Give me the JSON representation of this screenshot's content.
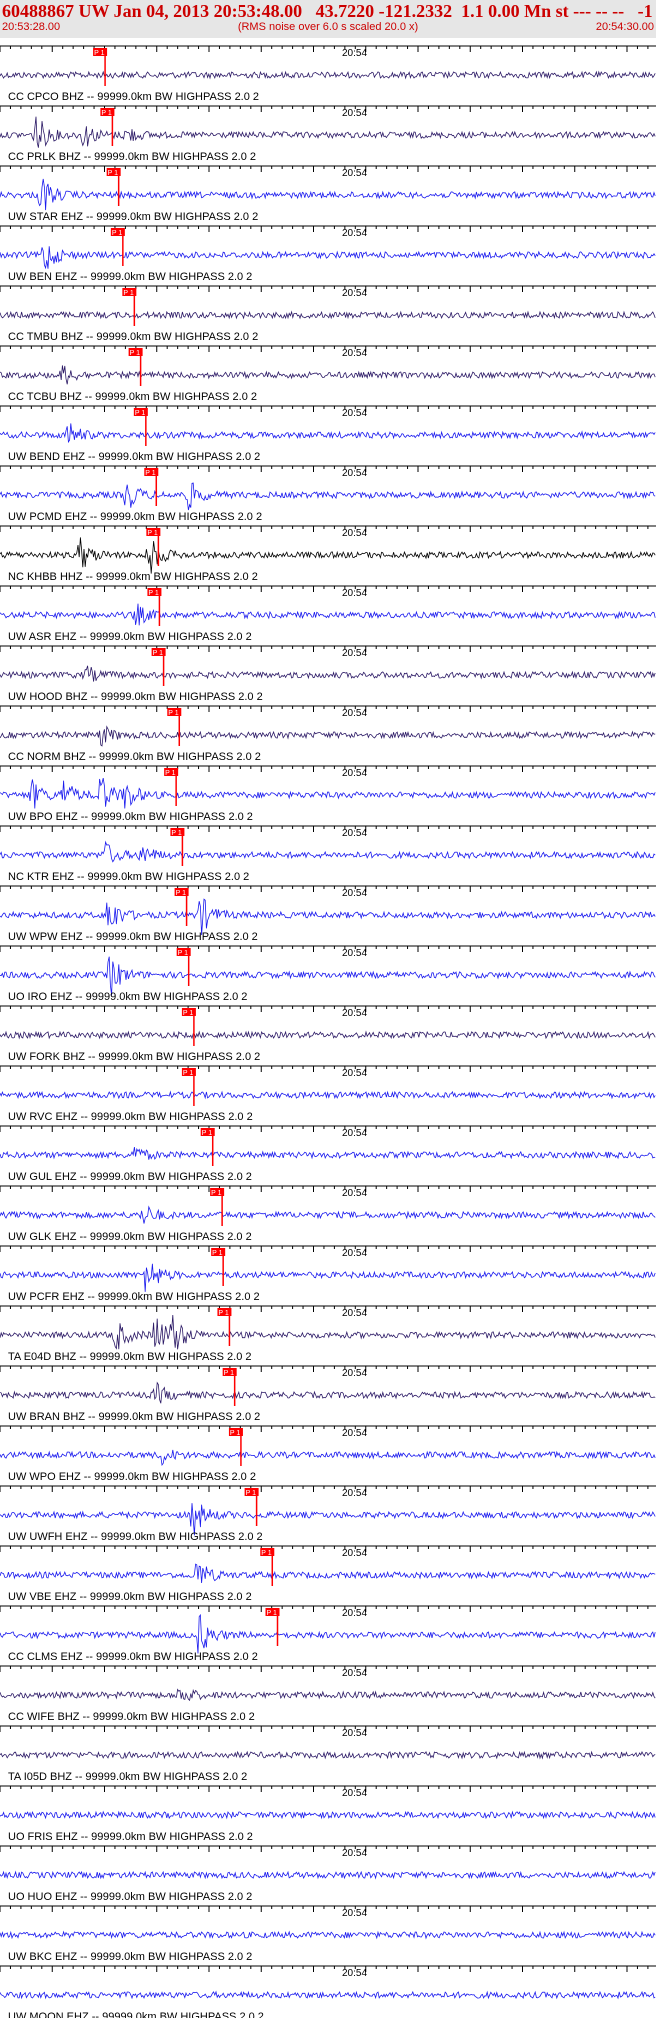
{
  "header": {
    "title": "60488867 UW Jan 04, 2013 20:53:48.00   43.7220 -121.2332  1.1 0.00 Mn st --- -- --   -1",
    "start_time": "20:53:28.00",
    "end_time": "20:54:30.00",
    "noise_note": "(RMS noise over 6.0 s scaled 20.0 x)"
  },
  "colors": {
    "pick": "#ff0000",
    "axis": "#000000",
    "text": "#000000",
    "label_bg": "#e6e6e6"
  },
  "chart_data": {
    "type": "line",
    "title": "60488867 UW Jan 04, 2013 20:53:48.00",
    "x_range": [
      "20:53:28.00",
      "20:54:30.00"
    ],
    "tick_label": "20:54",
    "pick_label": "P 1",
    "filter": "BW  HIGHPASS  2.0  2",
    "traces": [
      {
        "label": "CC CPCO BHZ -- 99999.0km",
        "color": "#2c1a66",
        "pick_s": 2.4,
        "events": []
      },
      {
        "label": "CC PRLK BHZ -- 99999.0km",
        "color": "#2c1a66",
        "pick_s": 3.1,
        "events": [
          [
            3.4,
            1.0
          ],
          [
            8.0,
            0.6
          ],
          [
            12.0,
            0.4
          ]
        ]
      },
      {
        "label": "UW STAR EHZ -- 99999.0km",
        "color": "#1a1aee",
        "pick_s": 3.7,
        "events": [
          [
            3.9,
            1.0
          ]
        ]
      },
      {
        "label": "UW BEN EHZ -- 99999.0km",
        "color": "#1a1aee",
        "pick_s": 4.1,
        "events": [
          [
            4.2,
            0.9
          ]
        ]
      },
      {
        "label": "CC TMBU BHZ -- 99999.0km",
        "color": "#2c1a66",
        "pick_s": 5.2,
        "events": []
      },
      {
        "label": "CC TCBU BHZ -- 99999.0km",
        "color": "#2c1a66",
        "pick_s": 5.8,
        "events": [
          [
            6.0,
            0.5
          ]
        ]
      },
      {
        "label": "UW BEND EHZ -- 99999.0km",
        "color": "#1a1aee",
        "pick_s": 6.3,
        "events": [
          [
            6.5,
            0.6
          ]
        ]
      },
      {
        "label": "UW PCMD EHZ -- 99999.0km",
        "color": "#1a1aee",
        "pick_s": 7.3,
        "events": [
          [
            12.0,
            0.8
          ],
          [
            18.0,
            0.7
          ]
        ]
      },
      {
        "label": "NC KHBB HHZ -- 99999.0km",
        "color": "#000000",
        "pick_s": 7.5,
        "events": [
          [
            7.6,
            0.8
          ],
          [
            14.2,
            1.0
          ]
        ]
      },
      {
        "label": "UW ASR EHZ -- 99999.0km",
        "color": "#1a1aee",
        "pick_s": 7.6,
        "events": [
          [
            13.0,
            0.5
          ]
        ]
      },
      {
        "label": "UW HOOD BHZ -- 99999.0km",
        "color": "#2c1a66",
        "pick_s": 8.0,
        "events": [
          [
            8.2,
            0.4
          ]
        ]
      },
      {
        "label": "CC NORM BHZ -- 99999.0km",
        "color": "#2c1a66",
        "pick_s": 9.5,
        "events": [
          [
            9.6,
            0.5
          ]
        ]
      },
      {
        "label": "UW BPO EHZ -- 99999.0km",
        "color": "#1a1aee",
        "pick_s": 9.2,
        "events": [
          [
            3.0,
            0.7
          ],
          [
            6.0,
            0.7
          ],
          [
            9.5,
            1.0
          ],
          [
            12.0,
            0.7
          ]
        ]
      },
      {
        "label": "NC KTR EHZ -- 99999.0km",
        "color": "#1a1aee",
        "pick_s": 9.8,
        "events": [
          [
            10.0,
            0.6
          ],
          [
            13.5,
            0.5
          ]
        ]
      },
      {
        "label": "UW WPW EHZ -- 99999.0km",
        "color": "#1a1aee",
        "pick_s": 10.2,
        "events": [
          [
            10.3,
            1.0
          ],
          [
            19.1,
            1.0
          ]
        ]
      },
      {
        "label": "UO IRO EHZ -- 99999.0km",
        "color": "#1a1aee",
        "pick_s": 10.4,
        "events": [
          [
            10.5,
            1.0
          ]
        ]
      },
      {
        "label": "UW FORK BHZ -- 99999.0km",
        "color": "#2c1a66",
        "pick_s": 10.9,
        "events": []
      },
      {
        "label": "UW RVC EHZ -- 99999.0km",
        "color": "#1a1aee",
        "pick_s": 10.9,
        "events": []
      },
      {
        "label": "UW GUL EHZ -- 99999.0km",
        "color": "#1a1aee",
        "pick_s": 12.7,
        "events": [
          [
            12.8,
            0.4
          ]
        ]
      },
      {
        "label": "UW GLK EHZ -- 99999.0km",
        "color": "#1a1aee",
        "pick_s": 13.6,
        "events": [
          [
            13.7,
            0.5
          ]
        ]
      },
      {
        "label": "UW PCFR EHZ -- 99999.0km",
        "color": "#1a1aee",
        "pick_s": 13.7,
        "events": [
          [
            14.0,
            1.0
          ]
        ]
      },
      {
        "label": "TA E04D BHZ -- 99999.0km",
        "color": "#2c1a66",
        "pick_s": 14.3,
        "events": [
          [
            11.0,
            0.8
          ],
          [
            14.8,
            1.0
          ],
          [
            16.5,
            0.9
          ]
        ]
      },
      {
        "label": "UW BRAN BHZ -- 99999.0km",
        "color": "#2c1a66",
        "pick_s": 14.8,
        "events": [
          [
            14.9,
            0.5
          ]
        ]
      },
      {
        "label": "UW WPO EHZ -- 99999.0km",
        "color": "#1a1aee",
        "pick_s": 15.4,
        "events": [
          [
            15.4,
            0.4
          ]
        ]
      },
      {
        "label": "UW UWFH EHZ -- 99999.0km",
        "color": "#1a1aee",
        "pick_s": 16.9,
        "events": [
          [
            18.4,
            1.0
          ]
        ]
      },
      {
        "label": "UW VBE EHZ -- 99999.0km",
        "color": "#1a1aee",
        "pick_s": 18.4,
        "events": [
          [
            18.8,
            0.8
          ]
        ]
      },
      {
        "label": "CC CLMS EHZ -- 99999.0km",
        "color": "#1a1aee",
        "pick_s": 18.9,
        "events": [
          [
            19.0,
            1.0
          ]
        ]
      },
      {
        "label": "CC WIFE BHZ -- 99999.0km",
        "color": "#2c1a66",
        "pick_s": null,
        "events": [
          [
            17.2,
            0.5
          ]
        ]
      },
      {
        "label": "TA I05D BHZ -- 99999.0km",
        "color": "#2c1a66",
        "pick_s": null,
        "events": []
      },
      {
        "label": "UO FRIS EHZ -- 99999.0km",
        "color": "#1a1aee",
        "pick_s": null,
        "events": []
      },
      {
        "label": "UO HUO EHZ -- 99999.0km",
        "color": "#1a1aee",
        "pick_s": null,
        "events": []
      },
      {
        "label": "UW BKC EHZ -- 99999.0km",
        "color": "#1a1aee",
        "pick_s": null,
        "events": []
      },
      {
        "label": "UW MOON EHZ -- 99999.0km",
        "color": "#1a1aee",
        "pick_s": null,
        "events": []
      }
    ]
  }
}
